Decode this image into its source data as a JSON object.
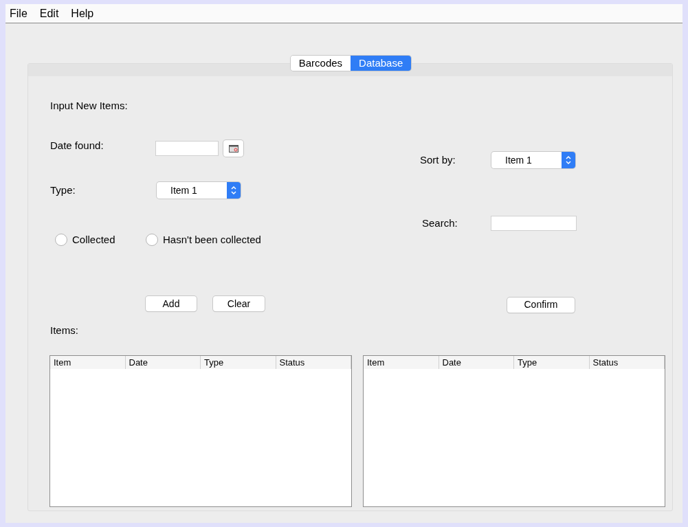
{
  "menu": [
    "File",
    "Edit",
    "Help"
  ],
  "tabs": [
    {
      "label": "Barcodes",
      "selected": false
    },
    {
      "label": "Database",
      "selected": true
    }
  ],
  "input_section": {
    "title": "Input New Items:",
    "date_label": "Date found:",
    "type_label": "Type:",
    "type_value": "Item 1",
    "radios": [
      {
        "label": "Collected",
        "selected": false
      },
      {
        "label": "Hasn't been collected",
        "selected": false
      }
    ],
    "buttons": [
      "Add",
      "Clear"
    ]
  },
  "search_section": {
    "sort_label": "Sort by:",
    "sort_value": "Item 1",
    "search_label": "Search:",
    "button": "Confirm"
  },
  "items_label": "Items:",
  "tables": [
    {
      "columns": [
        "Item",
        "Date",
        "Type",
        "Status"
      ]
    },
    {
      "columns": [
        "Item",
        "Date",
        "Type",
        "Status"
      ]
    }
  ]
}
